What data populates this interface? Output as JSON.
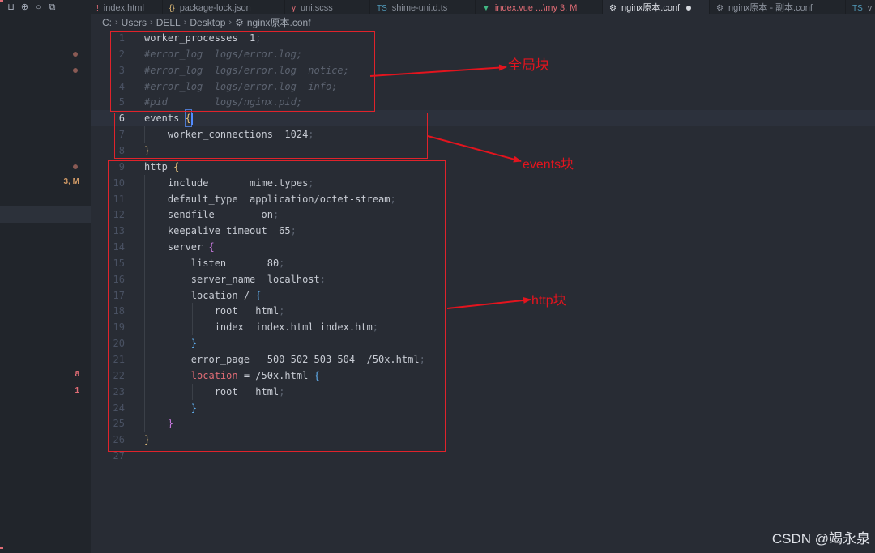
{
  "tabs": [
    {
      "icon": "!",
      "icon_name": "html-file-icon",
      "label": "index.html",
      "icon_color": "#e06c75"
    },
    {
      "icon": "{}",
      "icon_name": "json-file-icon",
      "label": "package-lock.json",
      "icon_color": "#e5c07b"
    },
    {
      "icon": "γ",
      "icon_name": "scss-file-icon",
      "label": "uni.scss",
      "icon_color": "#e06c75"
    },
    {
      "icon": "TS",
      "icon_name": "typescript-file-icon",
      "label": "shime-uni.d.ts",
      "icon_color": "#519aba"
    },
    {
      "icon": "▼",
      "icon_name": "vue-file-icon",
      "label": "index.vue  ...\\my 3, M",
      "icon_color": "#41b883",
      "label_color": "#e06c75"
    },
    {
      "icon": "⚙",
      "icon_name": "gear-icon",
      "label": "nginx原本.conf",
      "active": true
    },
    {
      "icon": "⚙",
      "icon_name": "gear-icon",
      "label": "nginx原本 - 副本.conf"
    },
    {
      "icon": "TS",
      "icon_name": "typescript-file-icon",
      "label": "vi",
      "icon_color": "#519aba"
    }
  ],
  "breadcrumb": {
    "parts": [
      "C:",
      "Users",
      "DELL",
      "Desktop"
    ],
    "file_icon": "gear-icon",
    "file": "nginx原本.conf"
  },
  "left_panel": {
    "decorations": [
      {
        "line": 2,
        "dot": true
      },
      {
        "line": 3,
        "dot": true
      },
      {
        "line": 9,
        "dot": true
      },
      {
        "line": 10,
        "text": "3, M"
      },
      {
        "line": 22,
        "text": "8"
      },
      {
        "line": 23,
        "text": "1"
      }
    ]
  },
  "editor": {
    "current_line": 6,
    "lines": [
      {
        "n": "1",
        "t": "worker_processes  1;"
      },
      {
        "n": "2",
        "t": "#error_log  logs/error.log;"
      },
      {
        "n": "3",
        "t": "#error_log  logs/error.log  notice;"
      },
      {
        "n": "4",
        "t": "#error_log  logs/error.log  info;"
      },
      {
        "n": "5",
        "t": "#pid        logs/nginx.pid;"
      },
      {
        "n": "6",
        "t": "events {"
      },
      {
        "n": "7",
        "t": "    worker_connections  1024;"
      },
      {
        "n": "8",
        "t": "}"
      },
      {
        "n": "9",
        "t": "http {"
      },
      {
        "n": "10",
        "t": "    include       mime.types;"
      },
      {
        "n": "11",
        "t": "    default_type  application/octet-stream;"
      },
      {
        "n": "12",
        "t": "    sendfile        on;"
      },
      {
        "n": "13",
        "t": "    keepalive_timeout  65;"
      },
      {
        "n": "14",
        "t": "    server {"
      },
      {
        "n": "15",
        "t": "        listen       80;"
      },
      {
        "n": "16",
        "t": "        server_name  localhost;"
      },
      {
        "n": "17",
        "t": "        location / {"
      },
      {
        "n": "18",
        "t": "            root   html;"
      },
      {
        "n": "19",
        "t": "            index  index.html index.htm;"
      },
      {
        "n": "20",
        "t": "        }"
      },
      {
        "n": "21",
        "t": "        error_page   500 502 503 504  /50x.html;"
      },
      {
        "n": "22",
        "t": "        location = /50x.html {"
      },
      {
        "n": "23",
        "t": "            root   html;"
      },
      {
        "n": "24",
        "t": "        }"
      },
      {
        "n": "25",
        "t": "    }"
      },
      {
        "n": "26",
        "t": "}"
      },
      {
        "n": "27",
        "t": ""
      }
    ]
  },
  "annotations": {
    "global_label": "全局块",
    "events_label": "events块",
    "http_label": "http块",
    "color": "#e3141e"
  },
  "watermark": "CSDN @竭永泉"
}
